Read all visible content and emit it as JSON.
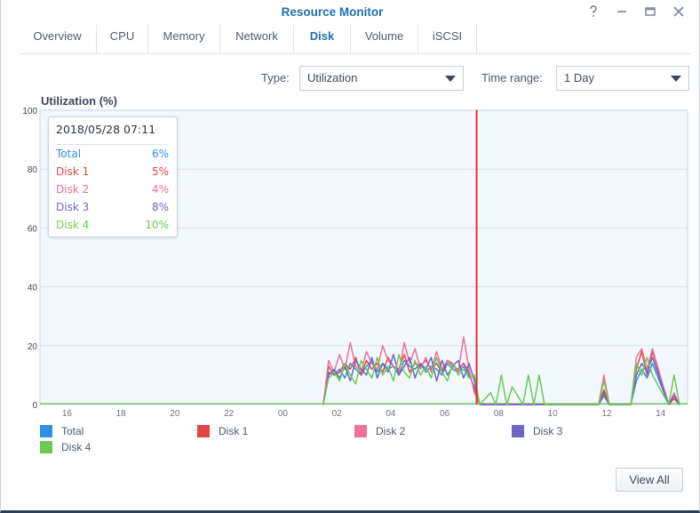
{
  "window": {
    "title": "Resource Monitor",
    "help_icon": "help-icon",
    "minimize_icon": "minimize-icon",
    "maximize_icon": "maximize-icon",
    "close_icon": "close-icon"
  },
  "tabs": [
    {
      "label": "Overview",
      "active": false
    },
    {
      "label": "CPU",
      "active": false
    },
    {
      "label": "Memory",
      "active": false
    },
    {
      "label": "Network",
      "active": false
    },
    {
      "label": "Disk",
      "active": true
    },
    {
      "label": "Volume",
      "active": false
    },
    {
      "label": "iSCSI",
      "active": false
    }
  ],
  "filters": {
    "type_label": "Type:",
    "type_value": "Utilization",
    "time_label": "Time range:",
    "time_value": "1 Day"
  },
  "tooltip": {
    "time": "2018/05/28 07:11",
    "rows": [
      {
        "name": "Total",
        "value": "6%"
      },
      {
        "name": "Disk 1",
        "value": "5%"
      },
      {
        "name": "Disk 2",
        "value": "4%"
      },
      {
        "name": "Disk 3",
        "value": "8%"
      },
      {
        "name": "Disk 4",
        "value": "10%"
      }
    ]
  },
  "legend": [
    {
      "name": "Total"
    },
    {
      "name": "Disk 1"
    },
    {
      "name": "Disk 2"
    },
    {
      "name": "Disk 3"
    },
    {
      "name": "Disk 4"
    }
  ],
  "colors": {
    "Total": "#2f8fe0",
    "Disk 1": "#e04848",
    "Disk 2": "#ef6f9d",
    "Disk 3": "#6f66c6",
    "Disk 4": "#6ccb52",
    "cursor": "#e0312f",
    "plot_bg": "#f3f8fc"
  },
  "buttons": {
    "view_all": "View All"
  },
  "chart_data": {
    "type": "line",
    "title": "Utilization (%)",
    "xlabel": "",
    "ylabel": "",
    "ylim": [
      0,
      100
    ],
    "yticks": [
      0,
      20,
      40,
      60,
      80,
      100
    ],
    "xlim": [
      15,
      15
    ],
    "x_tick_labels": [
      "16",
      "18",
      "20",
      "22",
      "00",
      "02",
      "04",
      "06",
      "08",
      "10",
      "12",
      "14"
    ],
    "grid": true,
    "legend_position": "bottom",
    "cursor_time": "2018/05/28 07:11",
    "x_hours": [
      1.5,
      1.7,
      1.9,
      2.1,
      2.3,
      2.5,
      2.7,
      2.9,
      3.1,
      3.3,
      3.5,
      3.7,
      3.9,
      4.1,
      4.3,
      4.5,
      4.7,
      4.9,
      5.1,
      5.3,
      5.5,
      5.7,
      5.9,
      6.1,
      6.3,
      6.5,
      6.7,
      6.9,
      7.1,
      7.3,
      7.7,
      7.9,
      8.1,
      8.3,
      8.5,
      8.9,
      9.1,
      9.3,
      9.5,
      9.7,
      11.7,
      11.9,
      12.1,
      12.9,
      13.1,
      13.3,
      13.5,
      13.7,
      14.3,
      14.5,
      14.7
    ],
    "series": [
      {
        "name": "Total",
        "values": [
          0,
          11,
          10,
          12,
          9,
          14,
          12,
          10,
          13,
          15,
          11,
          14,
          12,
          13,
          10,
          15,
          13,
          12,
          14,
          11,
          13,
          12,
          10,
          14,
          12,
          11,
          13,
          10,
          6,
          0,
          0,
          0,
          0,
          0,
          0,
          0,
          0,
          0,
          0,
          0,
          0,
          4,
          0,
          0,
          8,
          12,
          9,
          14,
          0,
          3,
          0
        ]
      },
      {
        "name": "Disk 1",
        "values": [
          0,
          13,
          10,
          11,
          14,
          12,
          16,
          10,
          15,
          12,
          14,
          11,
          16,
          13,
          12,
          17,
          11,
          14,
          13,
          15,
          12,
          14,
          11,
          15,
          13,
          12,
          14,
          11,
          5,
          0,
          0,
          0,
          0,
          0,
          0,
          0,
          0,
          0,
          0,
          0,
          0,
          5,
          0,
          0,
          12,
          18,
          10,
          18,
          0,
          2,
          0
        ]
      },
      {
        "name": "Disk 2",
        "values": [
          0,
          15,
          11,
          17,
          12,
          21,
          13,
          11,
          18,
          14,
          12,
          20,
          15,
          13,
          11,
          21,
          14,
          19,
          12,
          16,
          11,
          18,
          12,
          15,
          14,
          11,
          23,
          12,
          4,
          0,
          0,
          0,
          0,
          0,
          0,
          0,
          0,
          0,
          0,
          0,
          0,
          10,
          0,
          0,
          16,
          19,
          12,
          19,
          0,
          4,
          0
        ]
      },
      {
        "name": "Disk 3",
        "values": [
          0,
          10,
          12,
          9,
          13,
          8,
          15,
          12,
          10,
          16,
          9,
          14,
          11,
          17,
          10,
          13,
          16,
          9,
          14,
          12,
          16,
          8,
          15,
          10,
          13,
          15,
          9,
          14,
          8,
          0,
          0,
          0,
          0,
          0,
          0,
          0,
          0,
          0,
          0,
          0,
          0,
          3,
          0,
          0,
          10,
          14,
          11,
          16,
          0,
          3,
          0
        ]
      },
      {
        "name": "Disk 4",
        "values": [
          0,
          9,
          11,
          8,
          14,
          10,
          7,
          15,
          12,
          9,
          16,
          10,
          13,
          8,
          17,
          11,
          9,
          15,
          10,
          13,
          9,
          16,
          11,
          8,
          14,
          10,
          12,
          9,
          10,
          0,
          4,
          0,
          10,
          0,
          6,
          0,
          10,
          0,
          10,
          0,
          0,
          8,
          0,
          0,
          14,
          10,
          16,
          10,
          0,
          10,
          0
        ]
      }
    ]
  }
}
